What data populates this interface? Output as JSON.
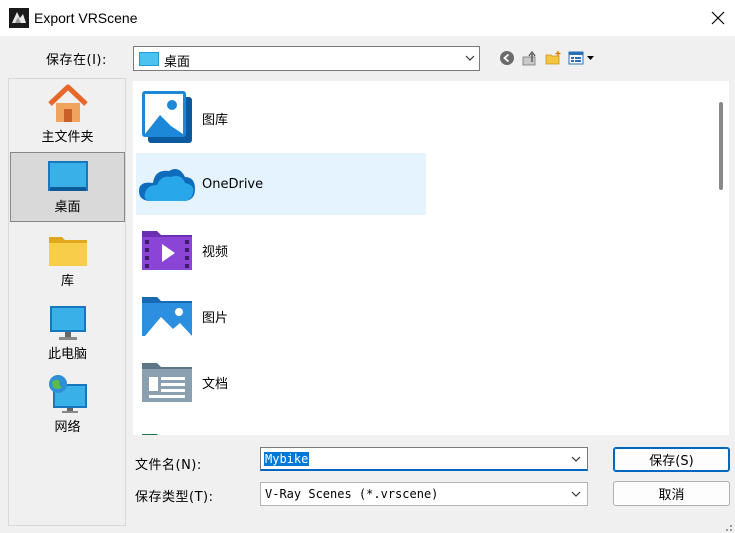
{
  "window": {
    "title": "Export VRScene",
    "app_icon": "3dsmax-logo-icon",
    "close_icon": "close-icon"
  },
  "lookin": {
    "label": "保存在(I):",
    "value": "桌面"
  },
  "toolbar": {
    "back_icon": "back-icon",
    "up_icon": "up-folder-icon",
    "new_folder_icon": "new-folder-icon",
    "view_icon": "view-menu-icon"
  },
  "places": [
    {
      "label": "主文件夹",
      "icon": "home-icon"
    },
    {
      "label": "桌面",
      "icon": "desktop-icon"
    },
    {
      "label": "库",
      "icon": "library-folder-icon"
    },
    {
      "label": "此电脑",
      "icon": "computer-icon"
    },
    {
      "label": "网络",
      "icon": "network-icon"
    }
  ],
  "files": [
    {
      "name": "图库",
      "icon": "gallery-icon"
    },
    {
      "name": "OneDrive",
      "icon": "onedrive-cloud-icon"
    },
    {
      "name": "视频",
      "icon": "videos-folder-icon"
    },
    {
      "name": "图片",
      "icon": "pictures-folder-icon"
    },
    {
      "name": "文档",
      "icon": "documents-folder-icon"
    }
  ],
  "filename": {
    "label": "文件名(N):",
    "value": "Mybike"
  },
  "filetype": {
    "label": "保存类型(T):",
    "value": "V-Ray Scenes (*.vrscene)"
  },
  "buttons": {
    "save": "保存(S)",
    "cancel": "取消"
  },
  "colors": {
    "accent": "#0067c0",
    "selection": "#0078d7",
    "hover": "#e5f3ff"
  }
}
